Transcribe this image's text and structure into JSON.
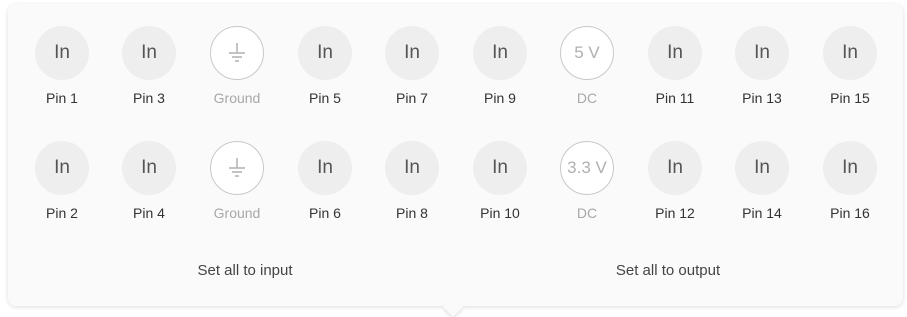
{
  "row1": [
    {
      "button": "In",
      "label": "Pin 1",
      "kind": "pin"
    },
    {
      "button": "In",
      "label": "Pin 3",
      "kind": "pin"
    },
    {
      "button": "",
      "icon": "ground-icon",
      "label": "Ground",
      "kind": "ground"
    },
    {
      "button": "In",
      "label": "Pin 5",
      "kind": "pin"
    },
    {
      "button": "In",
      "label": "Pin 7",
      "kind": "pin"
    },
    {
      "button": "In",
      "label": "Pin 9",
      "kind": "pin"
    },
    {
      "button": "5 V",
      "label": "DC",
      "kind": "power"
    },
    {
      "button": "In",
      "label": "Pin 11",
      "kind": "pin"
    },
    {
      "button": "In",
      "label": "Pin 13",
      "kind": "pin"
    },
    {
      "button": "In",
      "label": "Pin 15",
      "kind": "pin"
    }
  ],
  "row2": [
    {
      "button": "In",
      "label": "Pin 2",
      "kind": "pin"
    },
    {
      "button": "In",
      "label": "Pin 4",
      "kind": "pin"
    },
    {
      "button": "",
      "icon": "ground-icon",
      "label": "Ground",
      "kind": "ground"
    },
    {
      "button": "In",
      "label": "Pin 6",
      "kind": "pin"
    },
    {
      "button": "In",
      "label": "Pin 8",
      "kind": "pin"
    },
    {
      "button": "In",
      "label": "Pin 10",
      "kind": "pin"
    },
    {
      "button": "3.3 V",
      "label": "DC",
      "kind": "power"
    },
    {
      "button": "In",
      "label": "Pin 12",
      "kind": "pin"
    },
    {
      "button": "In",
      "label": "Pin 14",
      "kind": "pin"
    },
    {
      "button": "In",
      "label": "Pin 16",
      "kind": "pin"
    }
  ],
  "actions": {
    "set_all_input": "Set all to input",
    "set_all_output": "Set all to output"
  },
  "colors": {
    "panel_bg": "#fafafa",
    "pin_button_bg": "#eeeeee",
    "muted_text": "#a8a8a8"
  }
}
